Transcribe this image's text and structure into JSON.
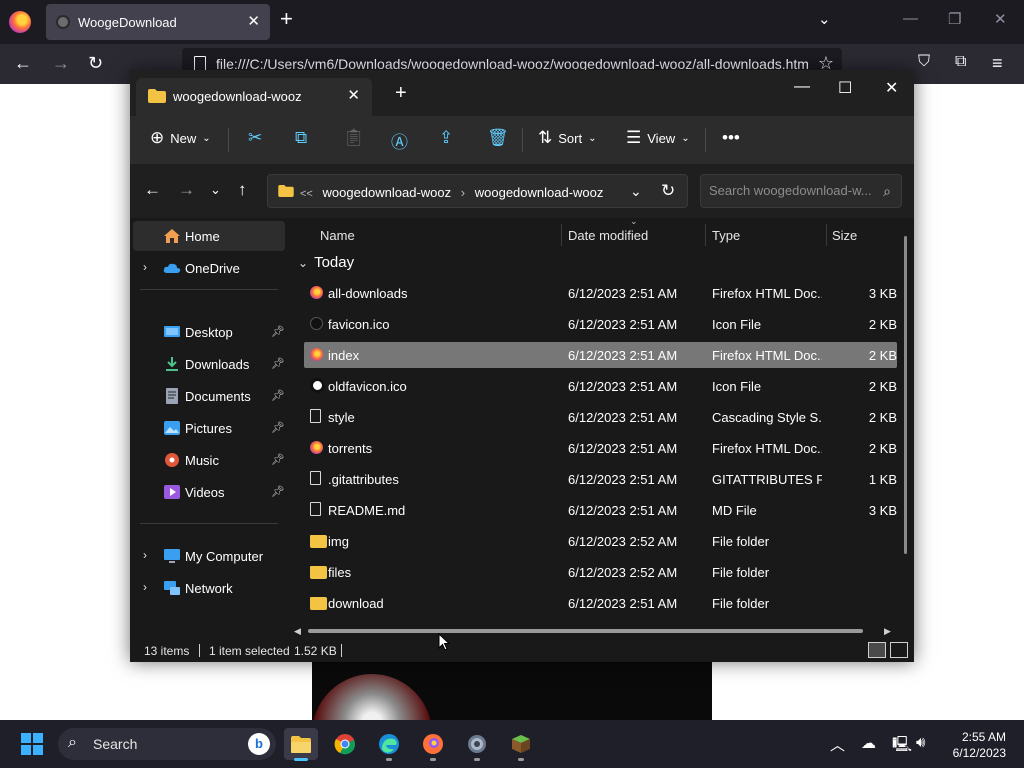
{
  "browser": {
    "tab_title": "WoogeDownload",
    "url": "file:///C:/Users/vm6/Downloads/woogedownload-wooz/woogedownload-wooz/all-downloads.htm"
  },
  "explorer": {
    "tab_title": "woogedownload-wooz",
    "toolbar": {
      "new_label": "New",
      "sort_label": "Sort",
      "view_label": "View"
    },
    "address": {
      "crumb_prefix": "<<",
      "crumbs": [
        "woogedownload-wooz",
        "woogedownload-wooz"
      ]
    },
    "search_placeholder": "Search woogedownload-w...",
    "nav": {
      "home": "Home",
      "onedrive": "OneDrive",
      "quick_access": [
        {
          "label": "Desktop",
          "icon": "desktop-icon"
        },
        {
          "label": "Downloads",
          "icon": "downloads-icon"
        },
        {
          "label": "Documents",
          "icon": "documents-icon"
        },
        {
          "label": "Pictures",
          "icon": "pictures-icon"
        },
        {
          "label": "Music",
          "icon": "music-icon"
        },
        {
          "label": "Videos",
          "icon": "videos-icon"
        }
      ],
      "my_computer": "My Computer",
      "network": "Network"
    },
    "columns": {
      "name": "Name",
      "date": "Date modified",
      "type": "Type",
      "size": "Size"
    },
    "group_label": "Today",
    "files": [
      {
        "name": "all-downloads",
        "date": "6/12/2023 2:51 AM",
        "type": "Firefox HTML Doc...",
        "size": "3 KB",
        "icon": "firefox"
      },
      {
        "name": "favicon.ico",
        "date": "6/12/2023 2:51 AM",
        "type": "Icon File",
        "size": "2 KB",
        "icon": "ico-dark"
      },
      {
        "name": "index",
        "date": "6/12/2023 2:51 AM",
        "type": "Firefox HTML Doc...",
        "size": "2 KB",
        "icon": "firefox",
        "selected": true
      },
      {
        "name": "oldfavicon.ico",
        "date": "6/12/2023 2:51 AM",
        "type": "Icon File",
        "size": "2 KB",
        "icon": "ico-light"
      },
      {
        "name": "style",
        "date": "6/12/2023 2:51 AM",
        "type": "Cascading Style S...",
        "size": "2 KB",
        "icon": "doc"
      },
      {
        "name": "torrents",
        "date": "6/12/2023 2:51 AM",
        "type": "Firefox HTML Doc...",
        "size": "2 KB",
        "icon": "firefox"
      },
      {
        "name": ".gitattributes",
        "date": "6/12/2023 2:51 AM",
        "type": "GITATTRIBUTES File",
        "size": "1 KB",
        "icon": "doc"
      },
      {
        "name": "README.md",
        "date": "6/12/2023 2:51 AM",
        "type": "MD File",
        "size": "3 KB",
        "icon": "doc"
      },
      {
        "name": "img",
        "date": "6/12/2023 2:52 AM",
        "type": "File folder",
        "size": "",
        "icon": "folder"
      },
      {
        "name": "files",
        "date": "6/12/2023 2:52 AM",
        "type": "File folder",
        "size": "",
        "icon": "folder"
      },
      {
        "name": "download",
        "date": "6/12/2023 2:51 AM",
        "type": "File folder",
        "size": "",
        "icon": "folder"
      }
    ],
    "status": {
      "items": "13 items",
      "selected": "1 item selected",
      "size": "1.52 KB"
    }
  },
  "taskbar": {
    "search_label": "Search",
    "apps": [
      "file-explorer",
      "chrome",
      "edge",
      "firefox",
      "settings",
      "minecraft"
    ],
    "time": "2:55 AM",
    "date": "6/12/2023"
  }
}
